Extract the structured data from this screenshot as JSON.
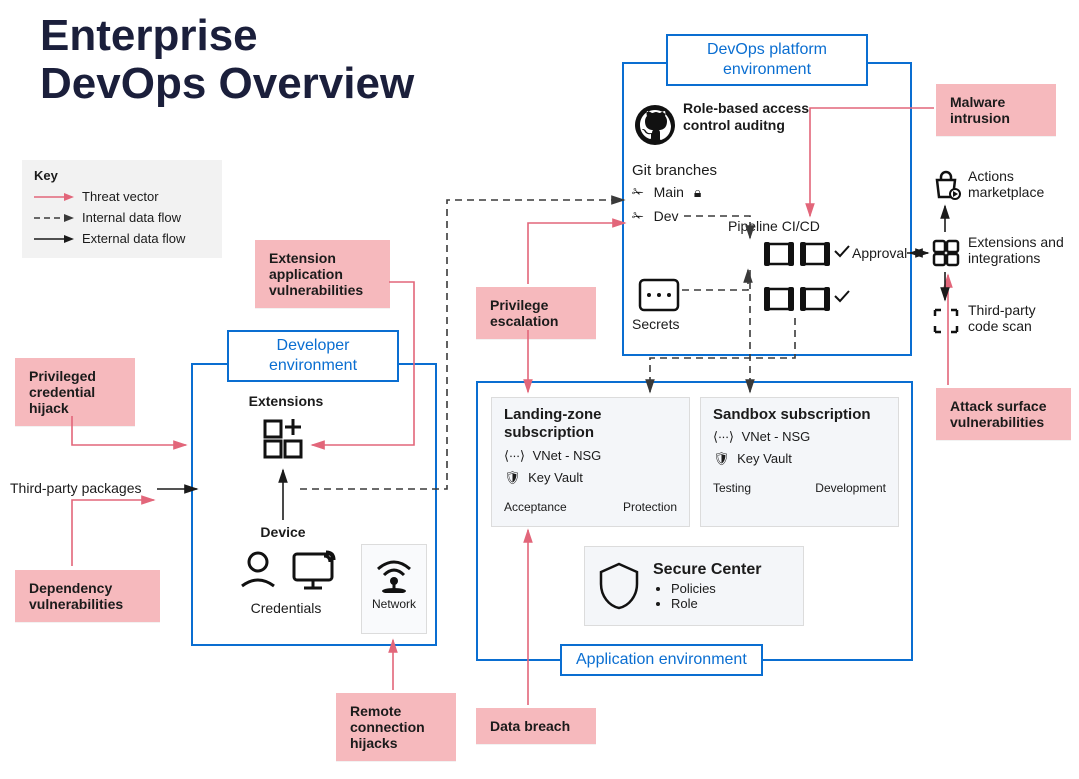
{
  "title": "Enterprise\nDevOps Overview",
  "key": {
    "heading": "Key",
    "threat": "Threat vector",
    "internal": "Internal data flow",
    "external": "External data flow"
  },
  "threats": {
    "priv_cred": "Privileged credential hijack",
    "dep_vuln": "Dependency vulnerabilities",
    "ext_app": "Extension application vulnerabilities",
    "remote": "Remote connection hijacks",
    "priv_esc": "Privilege escalation",
    "databreach": "Data breach",
    "malware": "Malware intrusion",
    "attack_surf": "Attack surface vulnerabilities"
  },
  "environments": {
    "developer": "Developer environment",
    "devops": "DevOps platform environment",
    "application": "Application environment"
  },
  "dev_env": {
    "extensions": "Extensions",
    "device": "Device",
    "credentials": "Credentials",
    "network": "Network",
    "third_party_packages": "Third-party packages"
  },
  "devops_env": {
    "rbac_title": "Role-based access control auditng",
    "git_branches": "Git branches",
    "branch_main": "Main",
    "branch_dev": "Dev",
    "pipeline": "Pipeline CI/CD",
    "approval": "Approval",
    "secrets": "Secrets"
  },
  "app_env": {
    "landing_title": "Landing-zone subscription",
    "sandbox_title": "Sandbox subscription",
    "vnet": "VNet - NSG",
    "keyvault": "Key Vault",
    "acceptance": "Acceptance",
    "protection": "Protection",
    "testing": "Testing",
    "development": "Development",
    "secure_center": "Secure Center",
    "policies": "Policies",
    "role": "Role"
  },
  "marketplace": {
    "actions": "Actions marketplace",
    "extensions": "Extensions and integrations",
    "scan": "Third-party code scan"
  }
}
